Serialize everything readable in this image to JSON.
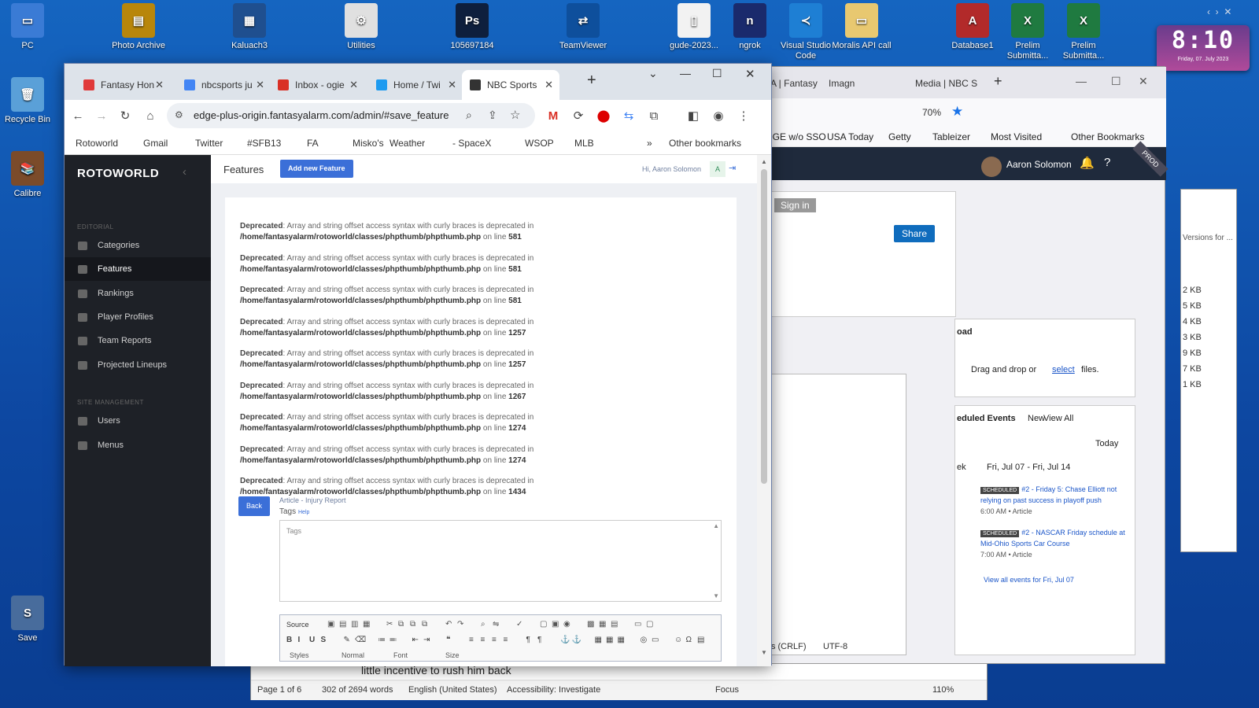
{
  "desktop_icons": [
    {
      "label": "PC",
      "color": "#3a7bd5",
      "glyph": "▭"
    },
    {
      "label": "Recycle Bin",
      "color": "#5aa0d8",
      "glyph": "🗑"
    },
    {
      "label": "Calibre",
      "color": "#7b4b2a",
      "glyph": "📚"
    },
    {
      "label": "Save",
      "color": "#486c9c",
      "glyph": "S"
    },
    {
      "label": "Photo Archive",
      "color": "#b8860b",
      "glyph": "▤"
    },
    {
      "label": "Kaluach3",
      "color": "#1f4f8f",
      "glyph": "▦"
    },
    {
      "label": "Utilities",
      "color": "#e0e0e0",
      "glyph": "⚙"
    },
    {
      "label": "105697184",
      "color": "#0e1f3d",
      "glyph": "Ps"
    },
    {
      "label": "TeamViewer",
      "color": "#0e4f9c",
      "glyph": "⇄"
    },
    {
      "label": "gude-2023...",
      "color": "#f2f2f2",
      "glyph": "▯"
    },
    {
      "label": "ngrok",
      "color": "#1a2a6c",
      "glyph": "n"
    },
    {
      "label": "Visual Studio Code",
      "color": "#1e7fd4",
      "glyph": "≺"
    },
    {
      "label": "Moralis API call",
      "color": "#e8c870",
      "glyph": "▭"
    },
    {
      "label": "Database1",
      "color": "#b22a2a",
      "glyph": "A"
    },
    {
      "label": "Prelim Submitta...",
      "color": "#1f7a40",
      "glyph": "X"
    },
    {
      "label": "Prelim Submitta...",
      "color": "#1f7a40",
      "glyph": "X"
    }
  ],
  "clock": {
    "time": "8:10",
    "date": "Friday, 07. July 2023"
  },
  "chrome": {
    "tabs": [
      {
        "label": "Fantasy Hon",
        "fav": "#e03a3a"
      },
      {
        "label": "nbcsports ju",
        "fav": "#4285f4"
      },
      {
        "label": "Inbox - ogie",
        "fav": "#d93025"
      },
      {
        "label": "Home / Twi",
        "fav": "#1d9bf0"
      },
      {
        "label": "NBC Sports",
        "fav": "#333"
      }
    ],
    "url": "edge-plus-origin.fantasyalarm.com/admin/#save_feature",
    "bookmarks": [
      "Rotoworld",
      "Gmail",
      "Twitter",
      "#SFB13",
      "FA",
      "Misko's",
      "Weather",
      "- SpaceX",
      "WSOP",
      "MLB",
      "»",
      "Other bookmarks"
    ]
  },
  "admin": {
    "logo": "ROTOWORLD",
    "page_title": "Features",
    "add_button": "Add new Feature",
    "greeting": "Hi, Aaron Solomon",
    "avatar": "A",
    "sections": {
      "editorial": "EDITORIAL",
      "site": "SITE MANAGEMENT"
    },
    "menu": [
      "Categories",
      "Features",
      "Rankings",
      "Player Profiles",
      "Team Reports",
      "Projected Lineups",
      "Users",
      "Menus"
    ],
    "deprecated": {
      "label": "Deprecated",
      "msg": ": Array and string offset access syntax with curly braces is deprecated in",
      "path": "/home/fantasyalarm/rotoworld/classes/phpthumb/phpthumb.php",
      "online": " on line ",
      "lines": [
        "581",
        "581",
        "581",
        "1257",
        "1257",
        "1267",
        "1274",
        "1274",
        "1434"
      ]
    },
    "back": "Back",
    "article_type": "Article - Injury Report",
    "tags_label": "Tags",
    "tags_help": "Help",
    "tags_placeholder": "Tags",
    "editor_source": "Source",
    "editor_styles": [
      "Styles",
      "Normal",
      "Font",
      "Size"
    ]
  },
  "firefox": {
    "tabs": [
      "BA | Fantasy",
      "Imagn",
      "Media | NBC S"
    ],
    "zoom": "70%",
    "bookmarks": [
      "EDGE w/o SSO",
      "USA Today",
      "Getty",
      "Tableizer",
      "Most Visited",
      "Other Bookmarks"
    ],
    "user": "Aaron Solomon",
    "badge": "PROD",
    "signin": "Sign in",
    "share": "Share",
    "upload_title": "oad",
    "upload_text": "Drag and drop or",
    "upload_link": "select",
    "upload_tail": "files.",
    "events_title": "eduled Events",
    "events_new": "New",
    "events_all": "View All",
    "today": "Today",
    "week": "ek",
    "range": "Fri, Jul 07 - Fri, Jul 14",
    "events": [
      {
        "badge": "SCHEDULED",
        "title": "#2 - Friday 5: Chase Elliott not relying on past success in playoff push",
        "meta": "6:00 AM  •  Article"
      },
      {
        "badge": "SCHEDULED",
        "title": "#2 - NASCAR Friday schedule at Mid-Ohio Sports Car Course",
        "meta": "7:00 AM  •  Article"
      }
    ],
    "view_all": "View all events for Fri, Jul 07"
  },
  "notepad": {
    "encoding_left": "ws (CRLF)",
    "encoding": "UTF-8"
  },
  "word": {
    "status": [
      "Page 1 of 6",
      "302 of 2694 words",
      "English (United States)",
      "Accessibility: Investigate",
      "Focus",
      "110%"
    ],
    "text": "little incentive to rush him back"
  },
  "side_window": {
    "title": "Versions for ...",
    "sizes": [
      "2 KB",
      "5 KB",
      "4 KB",
      "3 KB",
      "9 KB",
      "7 KB",
      "1 KB"
    ]
  }
}
